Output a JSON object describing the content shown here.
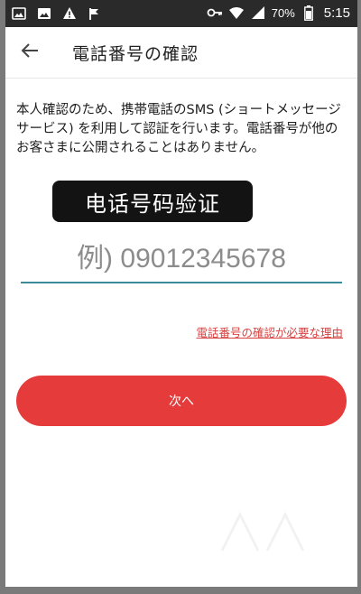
{
  "status_bar": {
    "battery": "70%",
    "time": "5:15",
    "icons": [
      "image-icon",
      "gallery-icon",
      "warning-icon",
      "flag-icon",
      "key-icon",
      "wifi-icon",
      "signal-icon",
      "battery-icon"
    ]
  },
  "app_bar": {
    "back_icon": "arrow-left-icon",
    "title": "電話番号の確認"
  },
  "main": {
    "description": "本人確認のため、携帯電話のSMS (ショートメッセージサービス) を利用して認証を行います。電話番号が他のお客さまに公開されることはありません。",
    "overlay_label": "电话号码验证",
    "phone_placeholder": "例) 09012345678",
    "phone_value": "",
    "reason_link": "電話番号の確認が必要な理由",
    "next_button": "次へ"
  },
  "colors": {
    "accent_red": "#e53b3b",
    "link_red": "#d94242",
    "input_underline": "#3a8a99",
    "status_bar_bg": "#2a2a2a"
  }
}
